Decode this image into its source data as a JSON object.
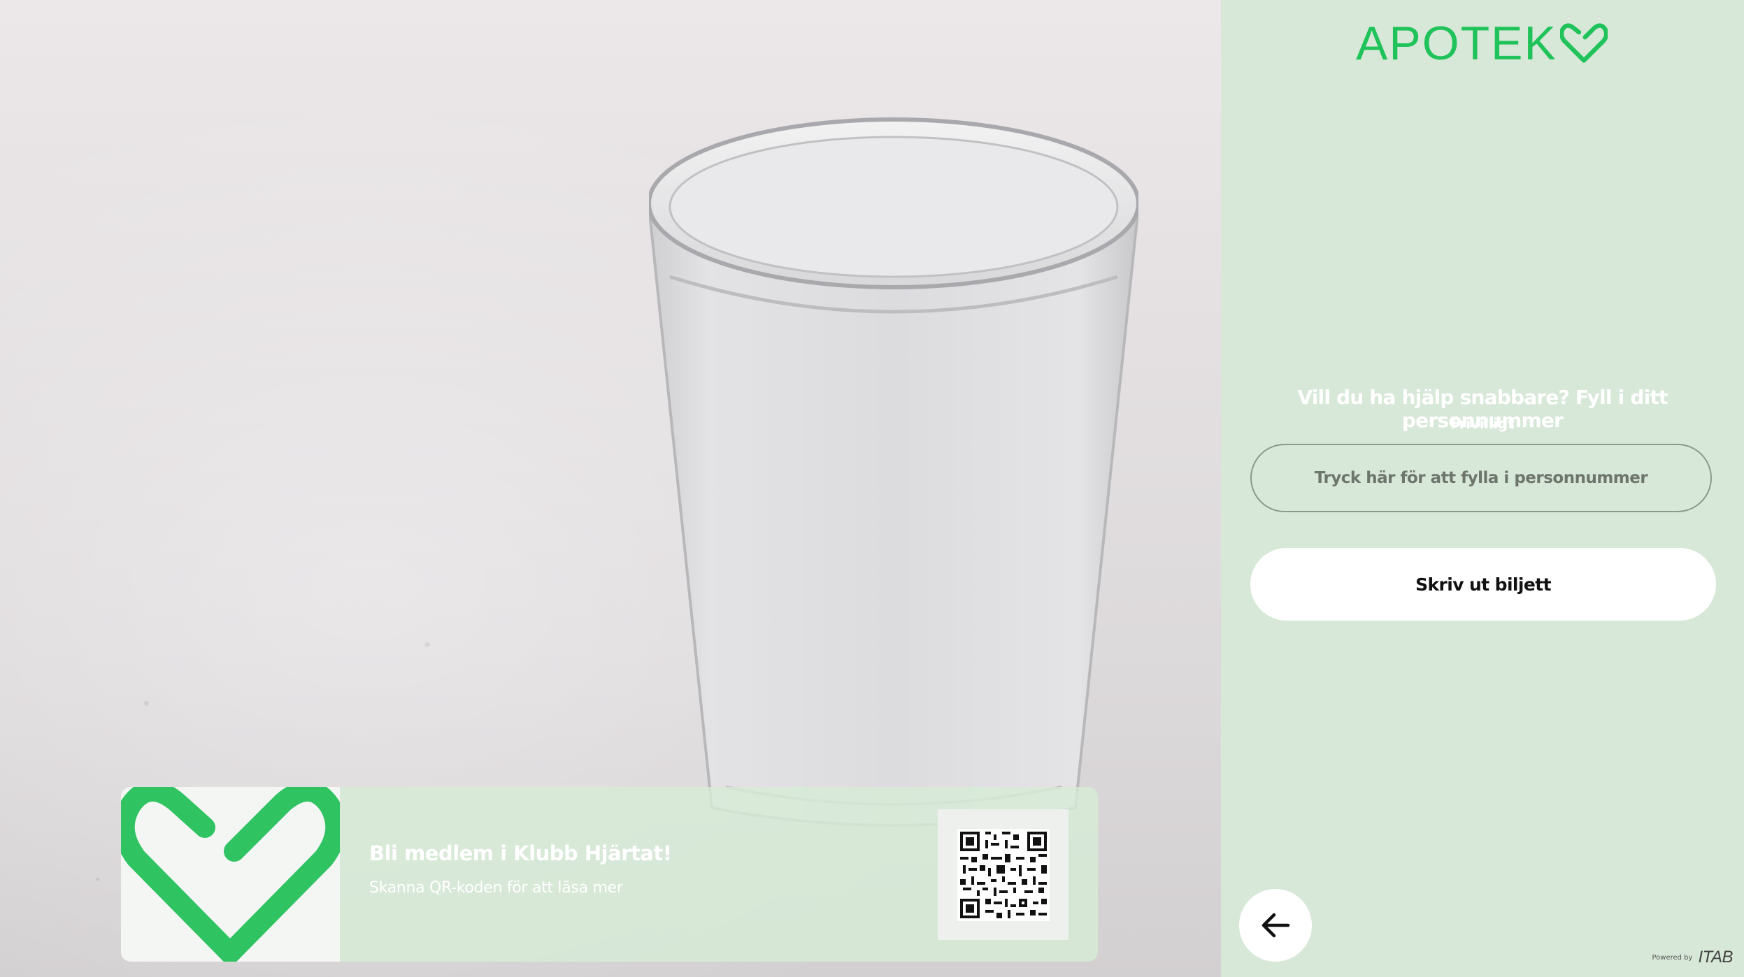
{
  "brand": {
    "logo_text": "APOTEK",
    "accent_color": "#1fc35a",
    "logo_icon": "heart-outline-icon"
  },
  "promo": {
    "title": "Bli medlem i Klubb Hjärtat!",
    "subtitle": "Skanna QR-koden för att läsa mer",
    "heart_icon": "heart-outline-icon",
    "qr_icon": "qr-code-icon",
    "heart_color": "#2fc362"
  },
  "form": {
    "question": "Vill du ha hjälp snabbare? Fyll i ditt personnummer",
    "optional_label": "Frivilligt",
    "personnummer_placeholder": "Tryck här för att fylla i personnummer",
    "print_button_label": "Skriv ut biljett"
  },
  "navigation": {
    "back_icon": "arrow-left-icon"
  },
  "footer": {
    "powered_by_label": "Powered by",
    "powered_by_brand": "ITAB"
  }
}
